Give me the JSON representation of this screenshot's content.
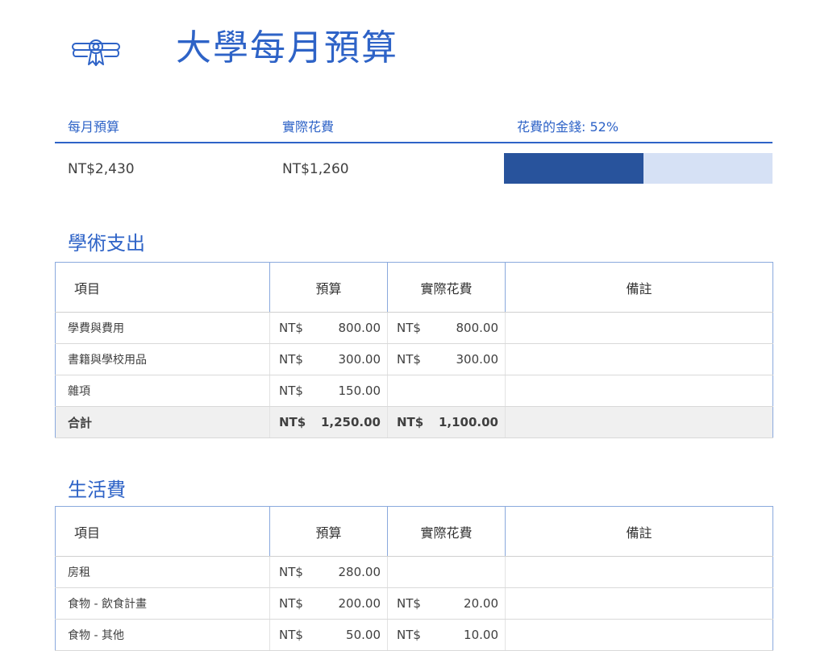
{
  "header": {
    "title": "大學每月預算",
    "logo_icon": "diploma-icon",
    "accent_color": "#2e63c7"
  },
  "summary": {
    "budget_label": "每月預算",
    "actual_label": "實際花費",
    "spent_label": "花費的金錢: 52%",
    "budget_value": "NT$2,430",
    "actual_value": "NT$1,260",
    "spent_percent": 52
  },
  "academic": {
    "title": "學術支出",
    "headers": {
      "item": "項目",
      "budget": "預算",
      "actual": "實際花費",
      "notes": "備註"
    },
    "rows": [
      {
        "item": "學費與費用",
        "budget_sym": "NT$",
        "budget": "800.00",
        "actual_sym": "NT$",
        "actual": "800.00",
        "notes": ""
      },
      {
        "item": "書籍與學校用品",
        "budget_sym": "NT$",
        "budget": "300.00",
        "actual_sym": "NT$",
        "actual": "300.00",
        "notes": ""
      },
      {
        "item": "雜項",
        "budget_sym": "NT$",
        "budget": "150.00",
        "actual_sym": "",
        "actual": "",
        "notes": ""
      }
    ],
    "total": {
      "item": "合計",
      "budget_sym": "NT$",
      "budget": "1,250.00",
      "actual_sym": "NT$",
      "actual": "1,100.00",
      "notes": ""
    }
  },
  "living": {
    "title": "生活費",
    "headers": {
      "item": "項目",
      "budget": "預算",
      "actual": "實際花費",
      "notes": "備註"
    },
    "rows": [
      {
        "item": "房租",
        "budget_sym": "NT$",
        "budget": "280.00",
        "actual_sym": "",
        "actual": "",
        "notes": ""
      },
      {
        "item": "食物 - 飲食計畫",
        "budget_sym": "NT$",
        "budget": "200.00",
        "actual_sym": "NT$",
        "actual": "20.00",
        "notes": ""
      },
      {
        "item": "食物 - 其他",
        "budget_sym": "NT$",
        "budget": "50.00",
        "actual_sym": "NT$",
        "actual": "10.00",
        "notes": ""
      }
    ]
  }
}
